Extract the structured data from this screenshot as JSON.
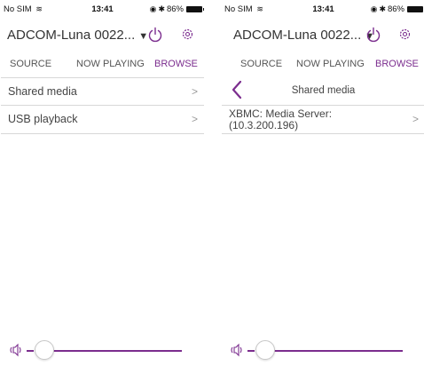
{
  "screens": [
    {
      "status": {
        "carrier": "No SIM",
        "time": "13:41",
        "battery": "86%"
      },
      "device": {
        "name": "ADCOM-Luna 0022..."
      },
      "tabs": {
        "source": "SOURCE",
        "now_playing": "NOW PLAYING",
        "browse": "BROWSE"
      },
      "list": [
        {
          "label": "Shared media"
        },
        {
          "label": "USB playback"
        }
      ]
    },
    {
      "status": {
        "carrier": "No SIM",
        "time": "13:41",
        "battery": "86%"
      },
      "device": {
        "name": "ADCOM-Luna 0022..."
      },
      "tabs": {
        "source": "SOURCE",
        "now_playing": "NOW PLAYING",
        "browse": "BROWSE"
      },
      "nav": {
        "title": "Shared media"
      },
      "list": [
        {
          "line1": "XBMC: Media Server:",
          "line2": "(10.3.200.196)"
        }
      ]
    }
  ],
  "colors": {
    "accent": "#7b2d8e",
    "text": "#444444",
    "separator": "#d8d8d8"
  }
}
